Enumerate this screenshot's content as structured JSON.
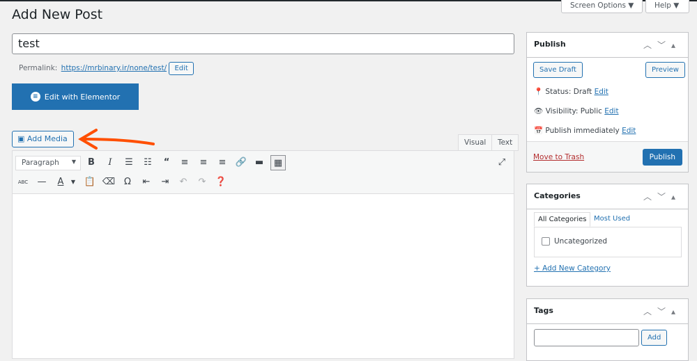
{
  "page_title": "Add New Post",
  "screen_options": "Screen Options ▼",
  "help": "Help ▼",
  "post_title": "test",
  "permalink": {
    "label": "Permalink:",
    "url": "https://mrbinary.ir/none/test/",
    "edit": "Edit"
  },
  "elementor_button": "Edit with Elementor",
  "add_media": "Add Media",
  "tabs": {
    "visual": "Visual",
    "text": "Text"
  },
  "format_select": "Paragraph",
  "publish": {
    "title": "Publish",
    "save_draft": "Save Draft",
    "preview": "Preview",
    "status": "Status: Draft",
    "visibility": "Visibility: Public",
    "schedule": "Publish immediately",
    "edit": "Edit",
    "trash": "Move to Trash",
    "publish_btn": "Publish"
  },
  "categories": {
    "title": "Categories",
    "tab_all": "All Categories",
    "tab_used": "Most Used",
    "items": [
      {
        "label": "Uncategorized",
        "checked": false
      }
    ],
    "add_new": "+ Add New Category"
  },
  "tags": {
    "title": "Tags",
    "add": "Add",
    "input_value": ""
  },
  "colors": {
    "accent": "#2271b1",
    "arrow": "#ff4f00",
    "trash": "#b32d2e"
  }
}
